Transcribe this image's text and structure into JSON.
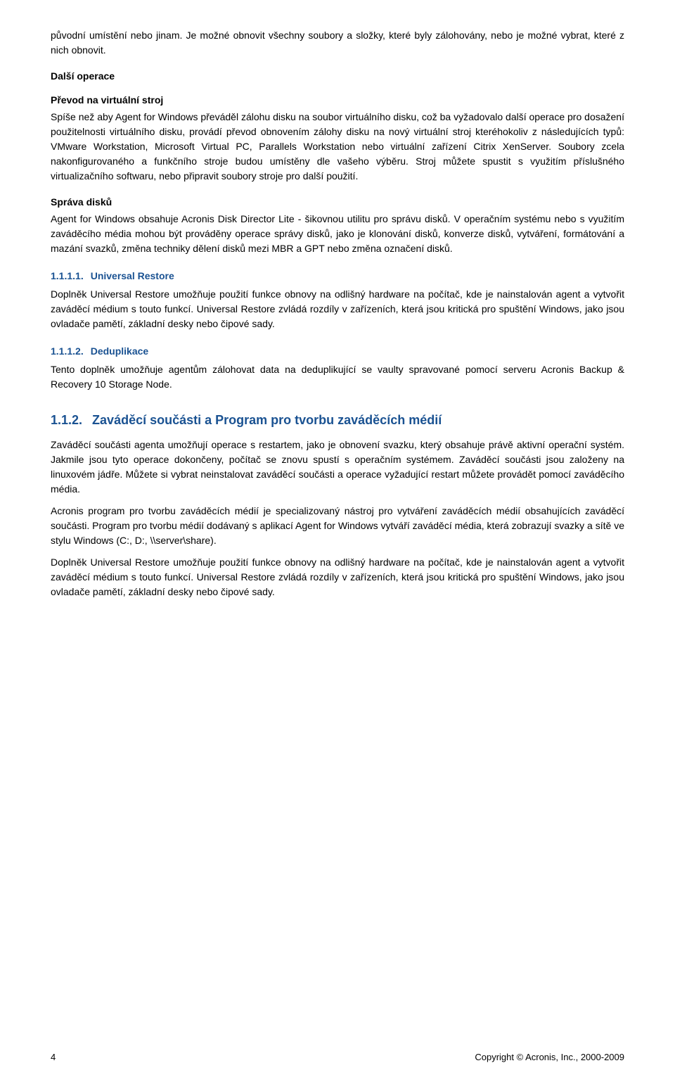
{
  "intro": {
    "para1": "původní umístění nebo jinam. Je možné obnovit všechny soubory a složky, které byly zálohovány, nebo je možné vybrat, které z nich obnovit.",
    "dalsi_operace_heading": "Další operace",
    "prevod_heading": "Převod na virtuální stroj",
    "prevod_para": "Spíše než aby Agent for Windows převáděl zálohu disku na soubor virtuálního disku, což ba vyžadovalo další operace pro dosažení použitelnosti virtuálního disku, provádí převod obnovením zálohy disku na nový virtuální stroj kteréhokoliv z následujících typů: VMware Workstation, Microsoft Virtual PC, Parallels Workstation nebo virtuální zařízení Citrix XenServer. Soubory zcela nakonfigurovaného a funkčního stroje budou umístěny dle vašeho výběru. Stroj můžete spustit s využitím příslušného virtualizačního softwaru, nebo připravit soubory stroje pro další použití.",
    "sprava_heading": "Správa disků",
    "sprava_para1": "Agent for Windows obsahuje Acronis Disk Director Lite - šikovnou utilitu pro správu disků. V operačním systému nebo s využitím zaváděcího média mohou být prováděny operace správy disků, jako je klonování disků, konverze disků, vytváření, formátování a mazání svazků, změna techniky dělení disků mezi MBR a GPT nebo změna označení disků."
  },
  "section_1111": {
    "number": "1.1.1.1.",
    "title": "Universal Restore",
    "para": "Doplněk Universal Restore umožňuje použití funkce obnovy na odlišný hardware na počítač, kde je nainstalován agent a vytvořit zaváděcí médium s touto funkcí. Universal Restore zvládá rozdíly v zařízeních, která jsou kritická pro spuštění Windows, jako jsou ovladače pamětí, základní desky nebo čipové sady."
  },
  "section_1112": {
    "number": "1.1.1.2.",
    "title": "Deduplikace",
    "para": "Tento doplněk umožňuje agentům zálohovat data na deduplikující se vaulty spravované pomocí serveru Acronis Backup & Recovery 10 Storage Node."
  },
  "section_112": {
    "number": "1.1.2.",
    "title": "Zaváděcí součásti a Program pro tvorbu zaváděcích médií",
    "para1": "Zaváděcí součásti agenta umožňují operace s restartem, jako je obnovení svazku, který obsahuje právě aktivní operační systém. Jakmile jsou tyto operace dokončeny, počítač se znovu spustí s operačním systémem. Zaváděcí součásti jsou založeny na linuxovém jádře. Můžete si vybrat neinstalovat zaváděcí součásti a operace vyžadující restart můžete provádět pomocí zaváděcího média.",
    "para2": "Acronis program pro tvorbu zaváděcích médií je specializovaný nástroj pro vytváření zaváděcích médií obsahujících zaváděcí součásti. Program pro tvorbu médií dodávaný s aplikací Agent for Windows vytváří zaváděcí média, která zobrazují svazky a sítě ve stylu Windows (C:, D:, \\\\server\\share).",
    "para3": "Doplněk Universal Restore umožňuje použití funkce obnovy na odlišný hardware na počítač, kde je nainstalován agent a vytvořit zaváděcí médium s touto funkcí. Universal Restore zvládá rozdíly v zařízeních, která jsou kritická pro spuštění Windows, jako jsou ovladače pamětí, základní desky nebo čipové sady."
  },
  "footer": {
    "page_number": "4",
    "copyright_text": "Copyright © Acronis, Inc., 2000-2009"
  }
}
